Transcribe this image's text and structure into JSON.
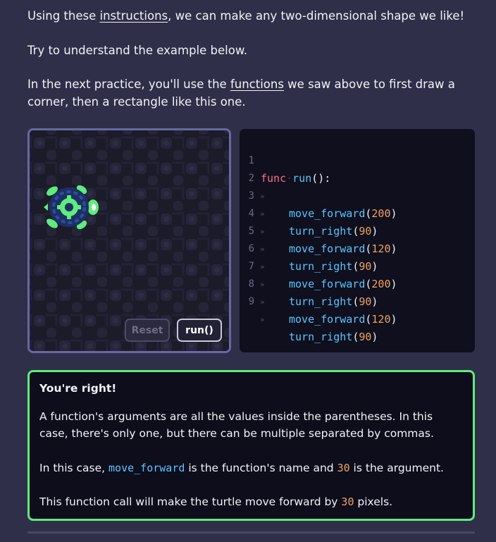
{
  "intro": {
    "p1": {
      "before": "Using these ",
      "link": "instructions",
      "after": ", we can make any two-dimensional shape we like!"
    },
    "p2": "Try to understand the example below.",
    "p3": {
      "before": "In the next practice, you'll use the ",
      "link": "functions",
      "after": " we saw above to first draw a corner, then a rectangle like this one."
    }
  },
  "canvas": {
    "buttons": {
      "reset": "Reset",
      "run": "run()"
    },
    "colors": {
      "border": "#6a67a3",
      "turtle": "#5eec7d"
    },
    "turtle_icon": "turtle-icon"
  },
  "code": {
    "line_numbers": [
      "1",
      "2",
      "3",
      "4",
      "5",
      "6",
      "7",
      "8",
      "9"
    ],
    "tab_marker": "»",
    "header": {
      "keyword": "func",
      "name": "run",
      "rest": "():"
    },
    "calls": [
      {
        "fn": "move_forward",
        "open": "(",
        "arg": "200",
        "close": ")"
      },
      {
        "fn": "turn_right",
        "open": "(",
        "arg": "90",
        "close": ")"
      },
      {
        "fn": "move_forward",
        "open": "(",
        "arg": "120",
        "close": ")"
      },
      {
        "fn": "turn_right",
        "open": "(",
        "arg": "90",
        "close": ")"
      },
      {
        "fn": "move_forward",
        "open": "(",
        "arg": "200",
        "close": ")"
      },
      {
        "fn": "turn_right",
        "open": "(",
        "arg": "90",
        "close": ")"
      },
      {
        "fn": "move_forward",
        "open": "(",
        "arg": "120",
        "close": ")"
      },
      {
        "fn": "turn_right",
        "open": "(",
        "arg": "90",
        "close": ")"
      }
    ]
  },
  "feedback": {
    "title": "You're right!",
    "p1": "A function's arguments are all the values inside the parentheses. In this case, there's only one, but there can be multiple separated by commas.",
    "p2": {
      "before": "In this case, ",
      "fn": "move_forward",
      "middle": " is the function's name and ",
      "num": "30",
      "after": " is the argument."
    },
    "p3": {
      "before": "This function call will make the turtle move forward by ",
      "num": "30",
      "after": " pixels."
    },
    "colors": {
      "border": "#5eec7d",
      "function": "#57c7ff",
      "number": "#f0a35e"
    }
  }
}
